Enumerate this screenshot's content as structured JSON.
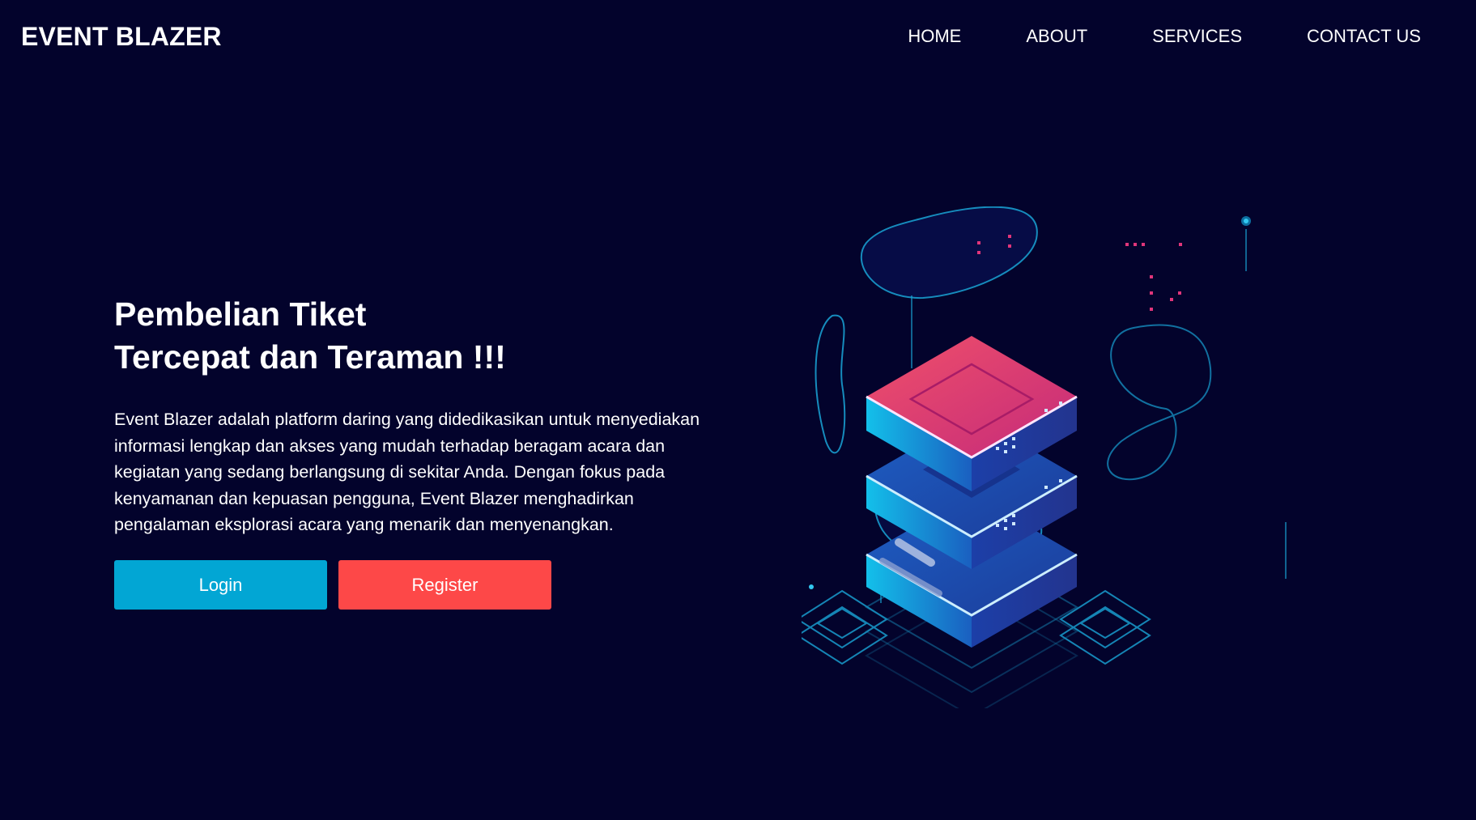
{
  "navbar": {
    "brand": "EVENT BLAZER",
    "links": [
      "HOME",
      "ABOUT",
      "SERVICES",
      "CONTACT US"
    ]
  },
  "hero": {
    "title_line1": "Pembelian Tiket",
    "title_line2": "Tercepat dan Teraman !!!",
    "description": "Event Blazer adalah platform daring yang didedikasikan untuk menyediakan informasi lengkap dan akses yang mudah terhadap beragam acara dan kegiatan yang sedang berlangsung di sekitar Anda. Dengan fokus pada kenyamanan dan kepuasan pengguna, Event Blazer menghadirkan pengalaman eksplorasi acara yang menarik dan menyenangkan.",
    "login_label": "Login",
    "register_label": "Register"
  },
  "illustration": {
    "icon": "isometric-server-stack-illustration"
  },
  "colors": {
    "background": "#03032c",
    "login_button": "#02a6d4",
    "register_button": "#fd4848",
    "accent_cyan": "#14b4e6",
    "accent_pink": "#e8416f"
  }
}
